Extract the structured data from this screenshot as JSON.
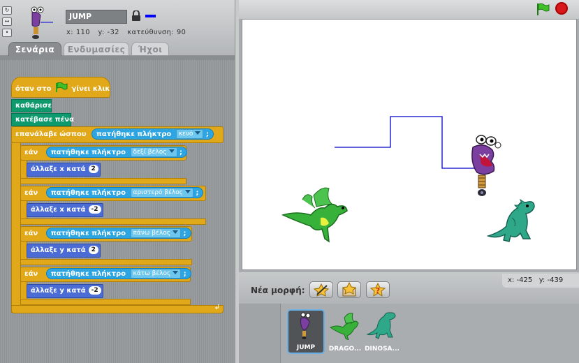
{
  "sprite": {
    "name": "JUMP",
    "x_label": "x:",
    "x_value": "110",
    "y_label": "y:",
    "y_value": "-32",
    "direction_label": "κατεύθυνση:",
    "direction_value": "90",
    "pen_color": "#0000ff"
  },
  "tabs": {
    "scripts": "Σενάρια",
    "costumes": "Ενδυμασίες",
    "sounds": "Ήχοι"
  },
  "script": {
    "hat_before": "όταν στο",
    "hat_after": "γίνει κλικ",
    "clear": "καθάρισε",
    "pen_down": "κατέβασε πένα",
    "repeat_until": "επανάλαβε ώσπου",
    "key_pressed": "πατήθηκε πλήκτρο",
    "if_label": "εάν",
    "change_x": "άλλαξε x κατά",
    "change_y": "άλλαξε y κατά",
    "key_space": "κενό",
    "key_right": "δεξί βέλος",
    "key_left": "αριστερό βέλος",
    "key_up": "πάνω βέλος",
    "key_down": "κάτω βέλος",
    "val_right": "2",
    "val_left": "-2",
    "val_up": "2",
    "val_down": "-2",
    "question_mark": ";"
  },
  "stage": {
    "new_sprite_label": "Νέα μορφή:",
    "mouse_x_label": "x:",
    "mouse_x": "-425",
    "mouse_y_label": "y:",
    "mouse_y": "-439"
  },
  "sprite_library": [
    {
      "name": "JUMP"
    },
    {
      "name": "DRAGO..."
    },
    {
      "name": "DINOSA..."
    }
  ],
  "colors": {
    "control": "#e1a91a",
    "pen": "#0e9a6c",
    "motion": "#4a6cd4",
    "sensing": "#2ca5e2",
    "pen_trail": "#0000cc"
  },
  "icons": [
    "rotate-all-icon",
    "rotate-lr-icon",
    "no-rotate-icon",
    "lock-icon",
    "green-flag-icon",
    "stop-icon",
    "paint-new-sprite-icon",
    "choose-sprite-icon",
    "surprise-sprite-icon"
  ]
}
